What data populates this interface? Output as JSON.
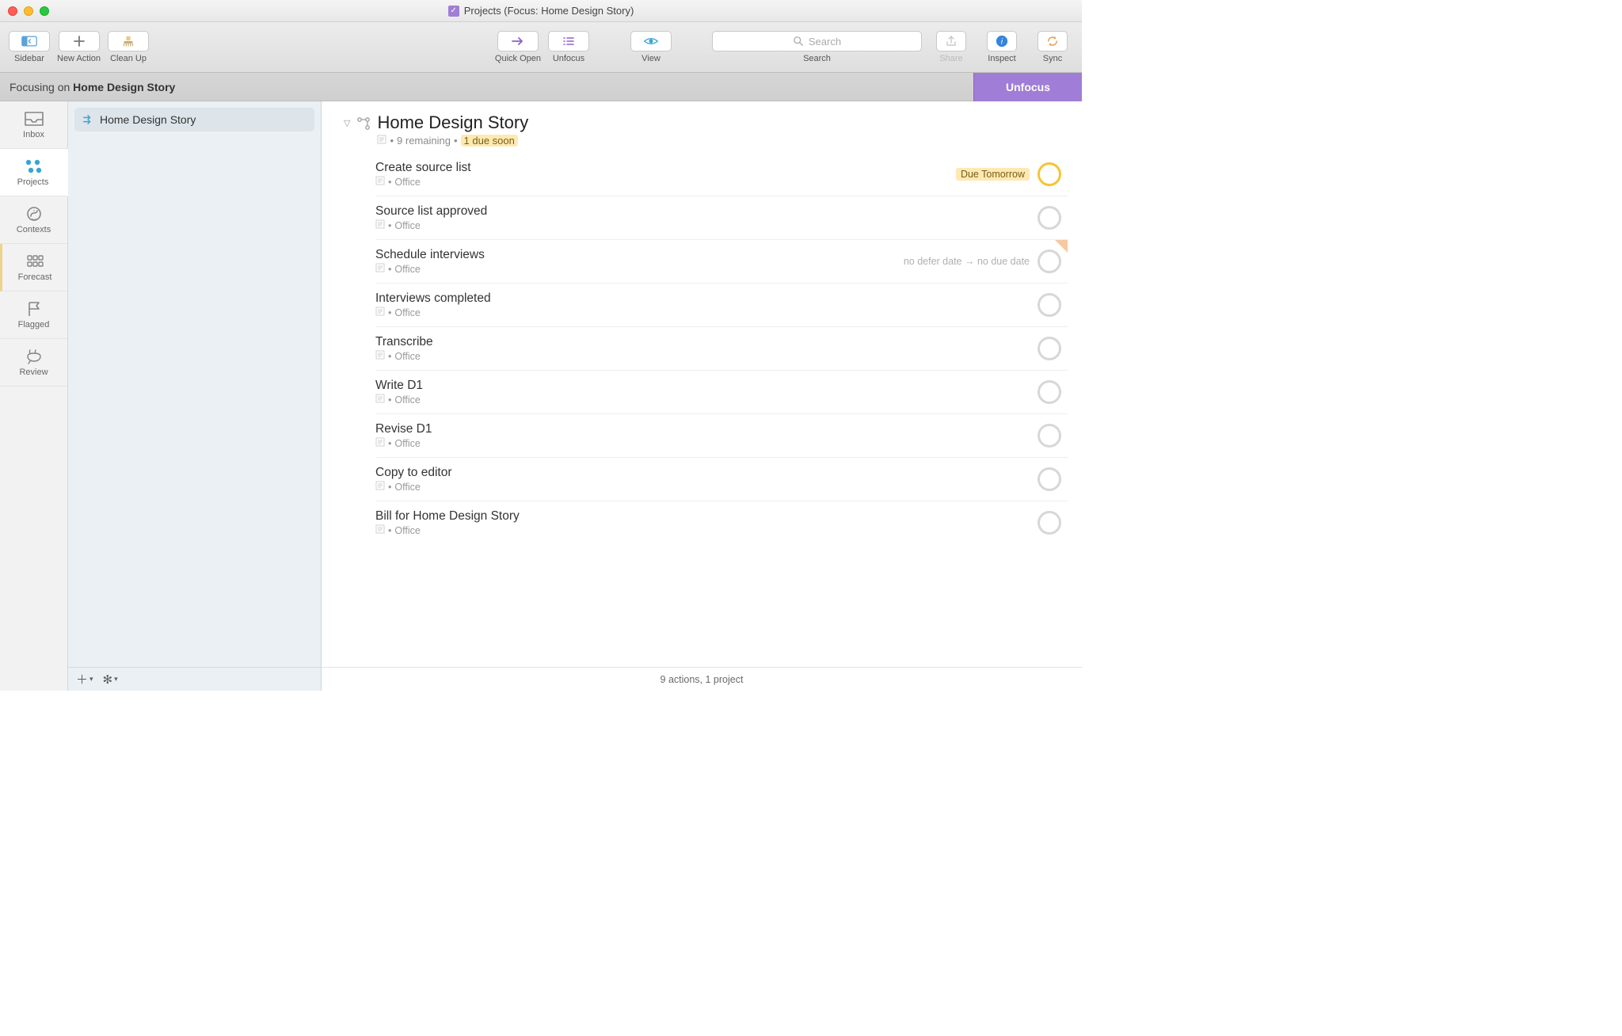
{
  "window": {
    "title": "Projects (Focus: Home Design Story)"
  },
  "toolbar": {
    "sidebar": "Sidebar",
    "new_action": "New Action",
    "clean_up": "Clean Up",
    "quick_open": "Quick Open",
    "unfocus": "Unfocus",
    "view": "View",
    "search_placeholder": "Search",
    "search_label": "Search",
    "share": "Share",
    "inspect": "Inspect",
    "sync": "Sync"
  },
  "focus": {
    "prefix": "Focusing on ",
    "project": "Home Design Story",
    "unfocus_button": "Unfocus"
  },
  "rail": {
    "inbox": "Inbox",
    "projects": "Projects",
    "contexts": "Contexts",
    "forecast": "Forecast",
    "flagged": "Flagged",
    "review": "Review"
  },
  "sidebar": {
    "project_name": "Home Design Story"
  },
  "project": {
    "title": "Home Design Story",
    "remaining": "9 remaining",
    "due_soon": "1 due soon"
  },
  "tasks": [
    {
      "title": "Create source list",
      "context": "Office",
      "due_label": "Due Tomorrow",
      "due_soon": true,
      "flagged": false,
      "defer_text": ""
    },
    {
      "title": "Source list approved",
      "context": "Office",
      "due_label": "",
      "due_soon": false,
      "flagged": false,
      "defer_text": ""
    },
    {
      "title": "Schedule interviews",
      "context": "Office",
      "due_label": "",
      "due_soon": false,
      "flagged": true,
      "defer_text": "no defer date → no due date"
    },
    {
      "title": "Interviews completed",
      "context": "Office",
      "due_label": "",
      "due_soon": false,
      "flagged": false,
      "defer_text": ""
    },
    {
      "title": "Transcribe",
      "context": "Office",
      "due_label": "",
      "due_soon": false,
      "flagged": false,
      "defer_text": ""
    },
    {
      "title": "Write D1",
      "context": "Office",
      "due_label": "",
      "due_soon": false,
      "flagged": false,
      "defer_text": ""
    },
    {
      "title": "Revise D1",
      "context": "Office",
      "due_label": "",
      "due_soon": false,
      "flagged": false,
      "defer_text": ""
    },
    {
      "title": "Copy to editor",
      "context": "Office",
      "due_label": "",
      "due_soon": false,
      "flagged": false,
      "defer_text": ""
    },
    {
      "title": "Bill for Home Design Story",
      "context": "Office",
      "due_label": "",
      "due_soon": false,
      "flagged": false,
      "defer_text": ""
    }
  ],
  "footer": {
    "summary": "9 actions, 1 project"
  }
}
